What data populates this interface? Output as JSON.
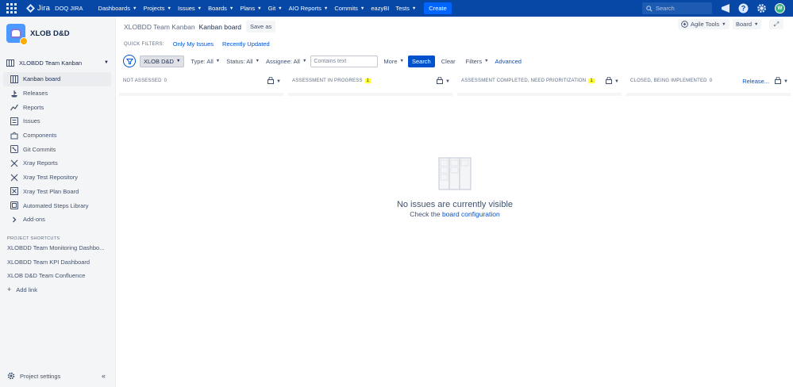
{
  "topnav": {
    "brand": "Jira",
    "instance": "DOQ JIRA",
    "items": [
      {
        "label": "Dashboards",
        "caret": true
      },
      {
        "label": "Projects",
        "caret": true
      },
      {
        "label": "Issues",
        "caret": true
      },
      {
        "label": "Boards",
        "caret": true
      },
      {
        "label": "Plans",
        "caret": true
      },
      {
        "label": "Git",
        "caret": true
      },
      {
        "label": "AIO Reports",
        "caret": true
      },
      {
        "label": "Commits",
        "caret": true
      },
      {
        "label": "eazyBI",
        "caret": false
      },
      {
        "label": "Tests",
        "caret": true
      }
    ],
    "create_label": "Create",
    "search_placeholder": "Search",
    "icons": [
      "app-switcher-icon",
      "notifications-icon",
      "help-icon",
      "settings-icon",
      "user-avatar"
    ],
    "avatar_initials": "W"
  },
  "sidebar": {
    "project_name": "XLOB D&D",
    "board_selector": "XLOBDD Team Kanban",
    "items": [
      {
        "label": "Kanban board",
        "icon": "board-icon",
        "active": true
      },
      {
        "label": "Releases",
        "icon": "ship-icon",
        "active": false
      },
      {
        "label": "Reports",
        "icon": "chart-icon",
        "active": false
      },
      {
        "label": "Issues",
        "icon": "issues-icon",
        "active": false
      },
      {
        "label": "Components",
        "icon": "puzzle-icon",
        "active": false
      },
      {
        "label": "Git Commits",
        "icon": "git-icon",
        "active": false
      },
      {
        "label": "Xray Reports",
        "icon": "xray-reports-icon",
        "active": false
      },
      {
        "label": "Xray Test Repository",
        "icon": "xray-repo-icon",
        "active": false
      },
      {
        "label": "Xray Test Plan Board",
        "icon": "xray-board-icon",
        "active": false
      },
      {
        "label": "Automated Steps Library",
        "icon": "library-icon",
        "active": false
      },
      {
        "label": "Add-ons",
        "icon": "chevron-right-icon",
        "active": false
      }
    ],
    "shortcuts_heading": "PROJECT SHORTCUTS",
    "shortcuts": [
      "XLOBDD Team Monitoring Dashbo...",
      "XLOBDD Team KPI Dashboard",
      "XLOB D&D Team Confluence"
    ],
    "add_link": "Add link",
    "project_settings": "Project settings"
  },
  "header": {
    "crumb_board": "XLOBDD Team Kanban",
    "crumb_page": "Kanban board",
    "save_as": "Save as",
    "agile_tools": "Agile Tools",
    "board_menu": "Board"
  },
  "quick_filters": {
    "label": "QUICK FILTERS:",
    "links": [
      "Only My Issues",
      "Recently Updated"
    ]
  },
  "filters": {
    "project_chip": "XLOB D&D",
    "type": "Type: All",
    "status": "Status: All",
    "assignee": "Assignee: All",
    "text_placeholder": "Contains text",
    "more": "More",
    "search": "Search",
    "clear": "Clear",
    "filters": "Filters",
    "advanced": "Advanced"
  },
  "columns": [
    {
      "title": "NOT ASSESSED",
      "count": "0",
      "highlight": false,
      "release": ""
    },
    {
      "title": "ASSESSMENT IN PROGRESS",
      "count": "1",
      "highlight": true,
      "release": ""
    },
    {
      "title": "ASSESSMENT COMPLETED, NEED PRIORITIZATION",
      "count": "1",
      "highlight": true,
      "release": ""
    },
    {
      "title": "CLOSED, BEING IMPLEMENTED",
      "count": "0",
      "highlight": false,
      "release": "Release..."
    }
  ],
  "empty_state": {
    "title": "No issues are currently visible",
    "sub_prefix": "Check the",
    "sub_link": "board configuration"
  },
  "colors": {
    "nav_bg": "#0747a6",
    "accent": "#0052cc",
    "highlight": "#ffff33"
  }
}
